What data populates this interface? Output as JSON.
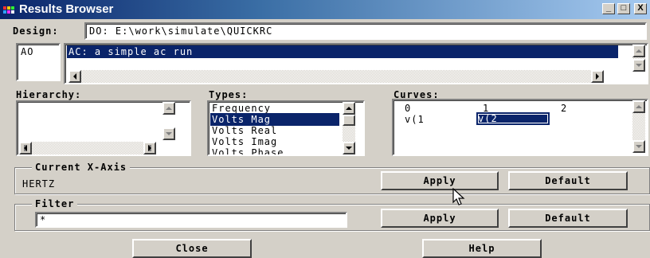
{
  "window": {
    "title": "Results Browser",
    "minimize": "_",
    "maximize": "□",
    "close": "X"
  },
  "design": {
    "label": "Design:",
    "value": "DO: E:\\work\\simulate\\QUICKRC"
  },
  "analysis": {
    "id_list": [
      "AO"
    ],
    "items": [
      "AC: a simple ac run"
    ],
    "selected_index": 0
  },
  "hierarchy": {
    "label": "Hierarchy:",
    "items": []
  },
  "types": {
    "label": "Types:",
    "items": [
      "Frequency",
      "Volts Mag",
      "Volts Real",
      "Volts Imag",
      "Volts Phase"
    ],
    "selected": "Volts Mag"
  },
  "curves": {
    "label": "Curves:",
    "headers": [
      "0",
      "1",
      "2"
    ],
    "row": [
      "v(1",
      "v(2"
    ],
    "selected": "v(2"
  },
  "x_axis": {
    "legend": "Current X-Axis",
    "value": "HERTZ",
    "apply": "Apply",
    "default": "Default"
  },
  "filter": {
    "legend": "Filter",
    "value": "*",
    "apply": "Apply",
    "default": "Default"
  },
  "footer": {
    "close": "Close",
    "help": "Help"
  },
  "colors": {
    "title_start": "#0a246a",
    "title_end": "#a6caf0",
    "selection": "#0a246a",
    "face": "#d4d0c8"
  }
}
